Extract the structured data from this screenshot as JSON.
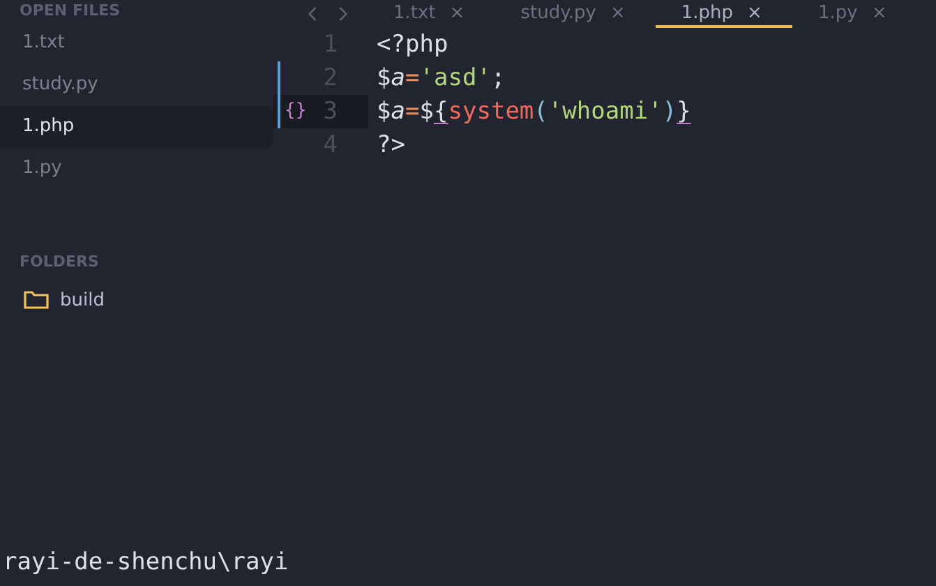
{
  "sidebar": {
    "open_files_title": "OPEN FILES",
    "files": [
      {
        "label": "1.txt",
        "selected": false
      },
      {
        "label": "study.py",
        "selected": false
      },
      {
        "label": "1.php",
        "selected": true
      },
      {
        "label": "1.py",
        "selected": false
      }
    ],
    "folders_title": "FOLDERS",
    "folders": [
      {
        "label": "build",
        "expanded": false
      }
    ]
  },
  "tabs": [
    {
      "label": "1.txt",
      "close": "×",
      "selected": false
    },
    {
      "label": "study.py",
      "close": "×",
      "selected": false
    },
    {
      "label": "1.php",
      "close": "×",
      "selected": true
    },
    {
      "label": "1.py",
      "close": "×",
      "selected": false
    }
  ],
  "editor": {
    "lines": [
      {
        "number": "1",
        "modified": false,
        "current": false,
        "tokens": [
          {
            "kind": "tag",
            "text": "<?php"
          }
        ]
      },
      {
        "number": "2",
        "modified": true,
        "current": false,
        "tokens": [
          {
            "kind": "plain",
            "text": "$"
          },
          {
            "kind": "var",
            "text": "a"
          },
          {
            "kind": "op",
            "text": "="
          },
          {
            "kind": "string",
            "text": "'asd'"
          },
          {
            "kind": "plain",
            "text": ";"
          }
        ]
      },
      {
        "number": "3",
        "modified": true,
        "current": true,
        "gutter_mark": "{}",
        "tokens": [
          {
            "kind": "plain",
            "text": "$"
          },
          {
            "kind": "var",
            "text": "a"
          },
          {
            "kind": "op",
            "text": "="
          },
          {
            "kind": "plain",
            "text": "$"
          },
          {
            "kind": "brace",
            "text": "{"
          },
          {
            "kind": "func",
            "text": "system"
          },
          {
            "kind": "paren",
            "text": "("
          },
          {
            "kind": "string",
            "text": "'whoami'"
          },
          {
            "kind": "paren",
            "text": ")"
          },
          {
            "kind": "brace",
            "text": "}"
          }
        ]
      },
      {
        "number": "4",
        "modified": false,
        "current": false,
        "tokens": [
          {
            "kind": "tag",
            "text": "?>"
          }
        ]
      }
    ]
  },
  "terminal": {
    "line": "rayi-de-shenchu\\rayi"
  }
}
